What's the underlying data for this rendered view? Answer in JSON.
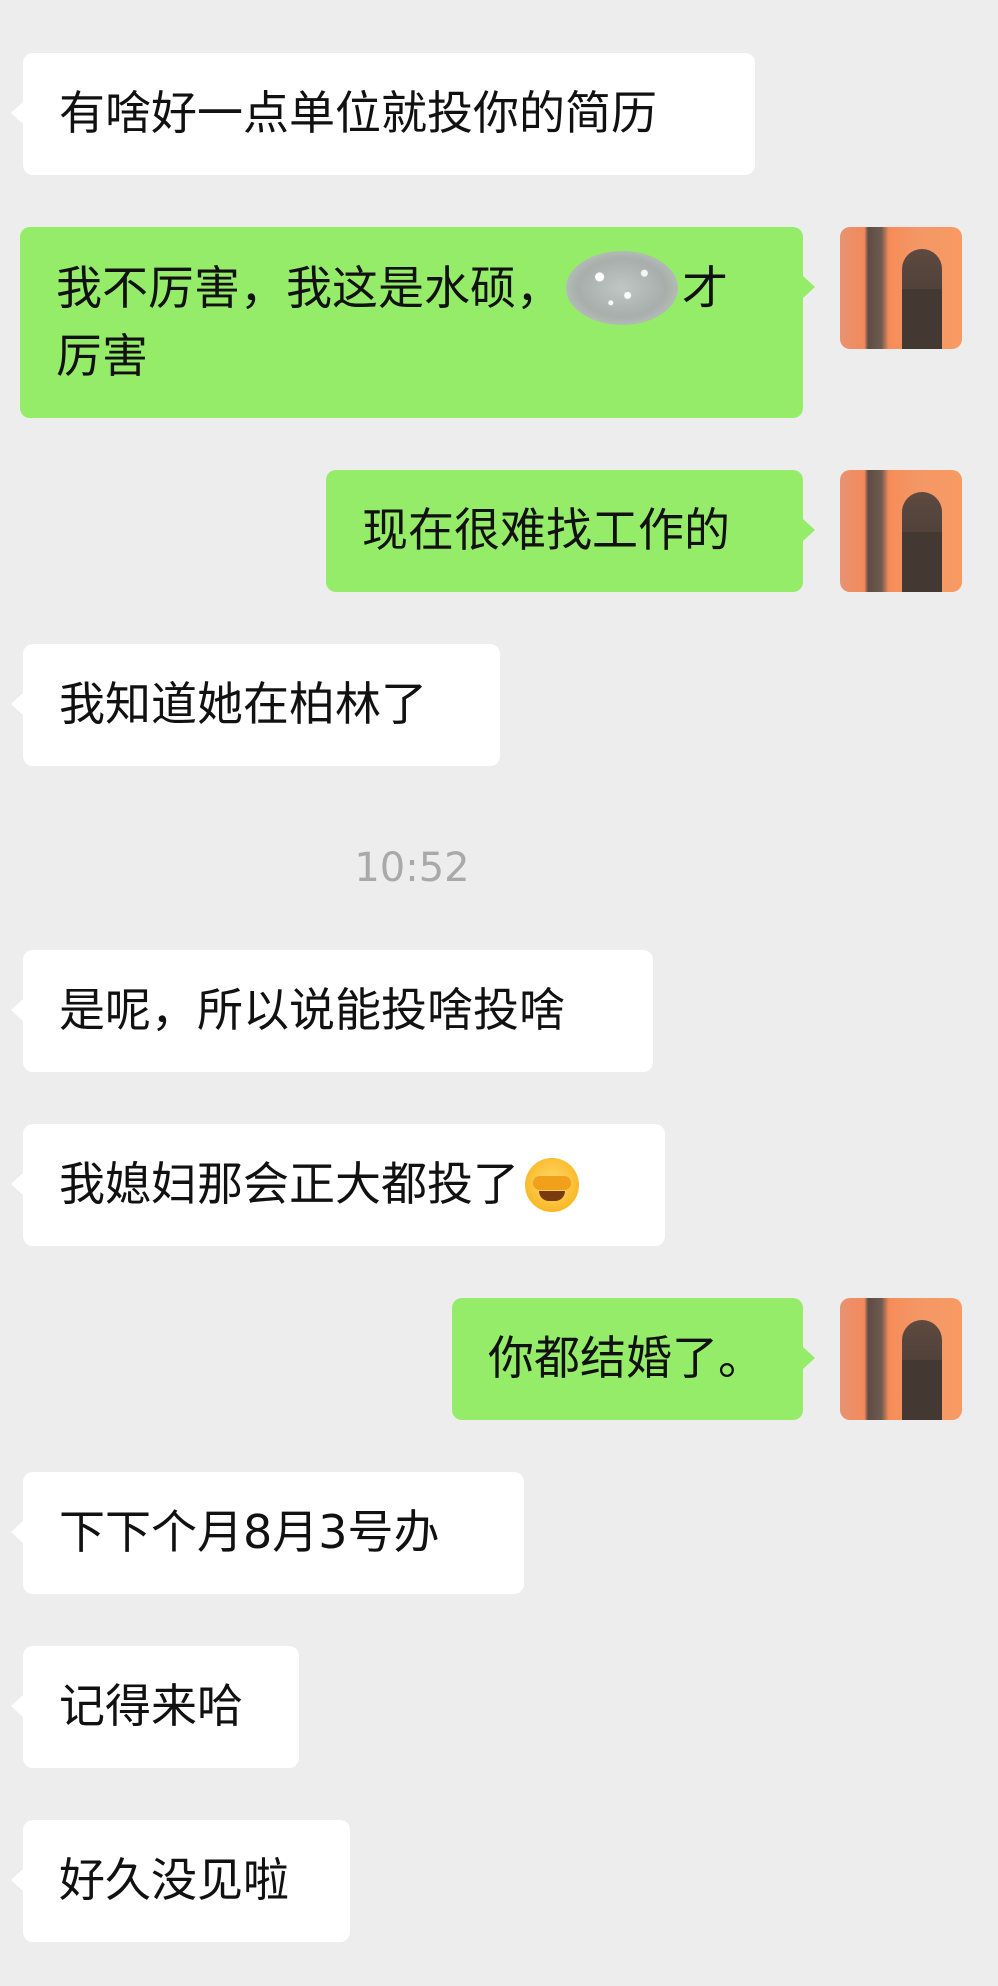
{
  "messages": [
    {
      "side": "left",
      "text": "有啥好一点单位就投你的简历"
    },
    {
      "side": "right",
      "text_before": "我不厉害，我这是水硕，",
      "text_after": "才",
      "line2": "厉害",
      "avatar": "user-avatar"
    },
    {
      "side": "right",
      "text": "现在很难找工作的",
      "avatar": "user-avatar"
    },
    {
      "side": "left",
      "text": "我知道她在柏林了"
    },
    {
      "side": "left",
      "text": "是呢，所以说能投啥投啥"
    },
    {
      "side": "left",
      "text": "我媳妇那会正大都投了",
      "emoji": "facepalm-crying-emoji"
    },
    {
      "side": "right",
      "text": "你都结婚了。",
      "avatar": "user-avatar"
    },
    {
      "side": "left",
      "text": "下下个月8月3号办"
    },
    {
      "side": "left",
      "text": "记得来哈"
    },
    {
      "side": "left",
      "text": "好久没见啦"
    }
  ],
  "timestamp": "10:52",
  "colors": {
    "background": "#ededed",
    "left_bubble": "#ffffff",
    "right_bubble": "#95ec69",
    "timestamp_text": "#a9a9a9"
  }
}
